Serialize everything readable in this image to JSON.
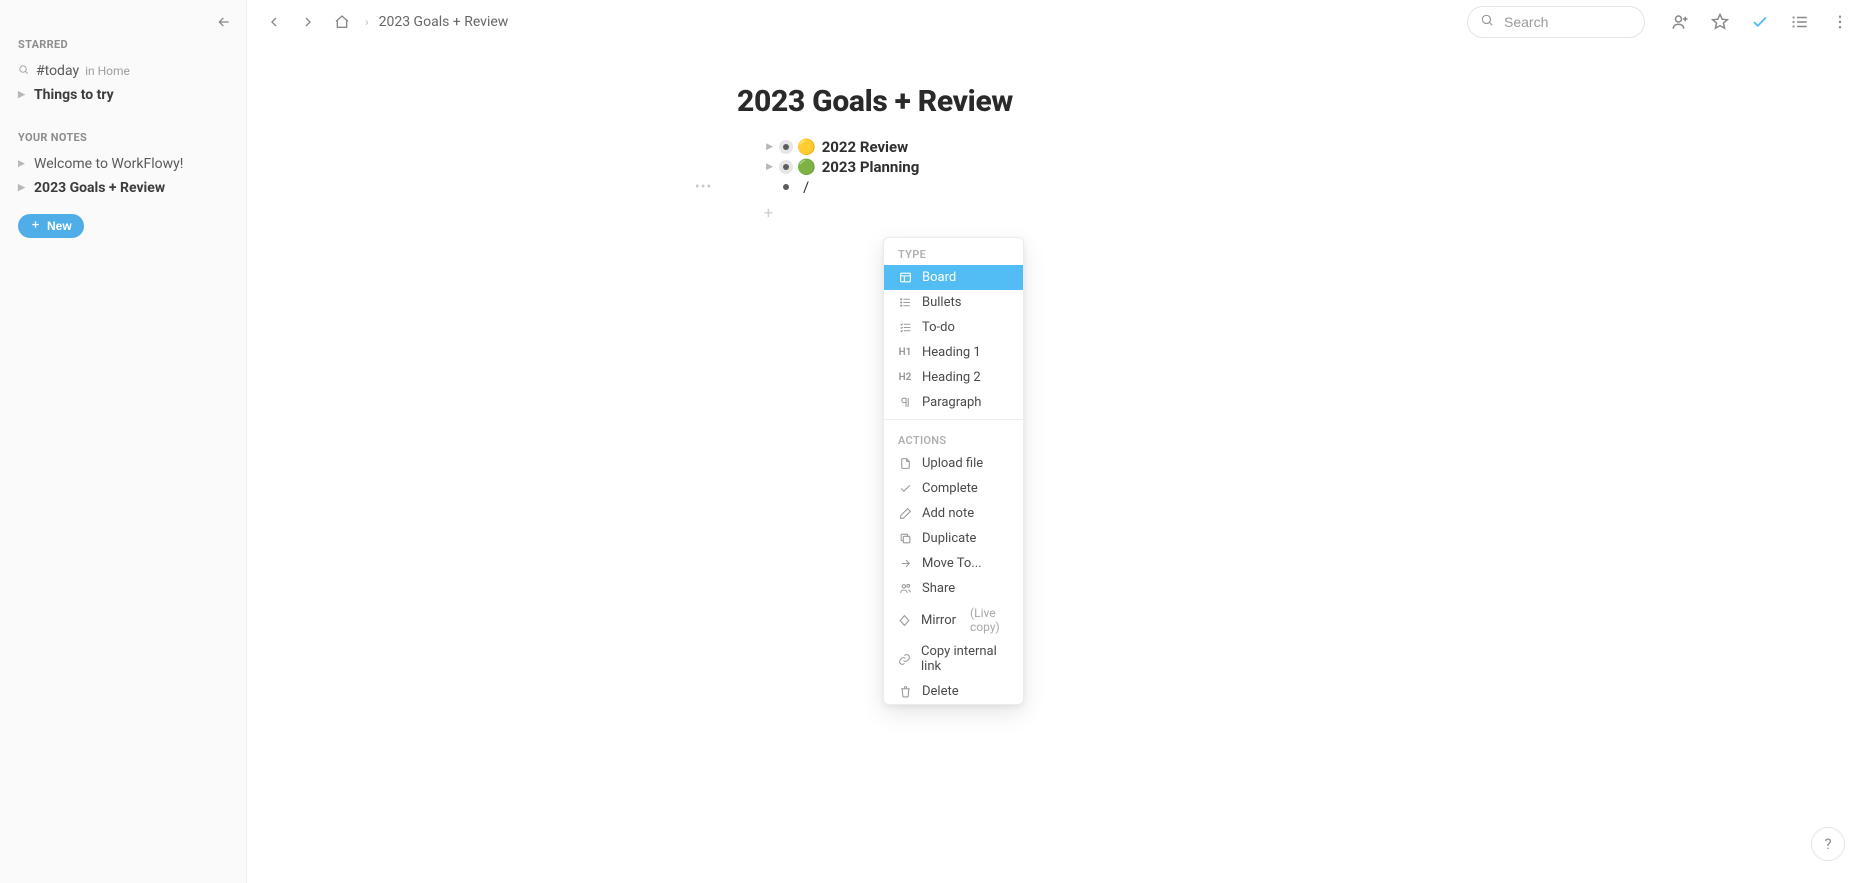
{
  "sidebar": {
    "starred_label": "STARRED",
    "today": {
      "tag": "#today",
      "in_label": "in Home"
    },
    "things_to_try": "Things to try",
    "your_notes_label": "YOUR NOTES",
    "notes": [
      {
        "label": "Welcome to WorkFlowy!"
      },
      {
        "label": "2023 Goals + Review"
      }
    ],
    "new_label": "New"
  },
  "topbar": {
    "breadcrumb": "2023 Goals + Review",
    "search_placeholder": "Search"
  },
  "doc": {
    "title": "2023 Goals + Review",
    "items": [
      {
        "emoji": "🟡",
        "label": "2022 Review"
      },
      {
        "emoji": "🟢",
        "label": "2023 Planning"
      }
    ],
    "slash_input": "/"
  },
  "popup": {
    "type_label": "TYPE",
    "types": [
      {
        "label": "Board",
        "icon": "board",
        "selected": true
      },
      {
        "label": "Bullets",
        "icon": "bullets"
      },
      {
        "label": "To-do",
        "icon": "todo"
      },
      {
        "label": "Heading 1",
        "icon": "H1"
      },
      {
        "label": "Heading 2",
        "icon": "H2"
      },
      {
        "label": "Paragraph",
        "icon": "paragraph"
      }
    ],
    "actions_label": "ACTIONS",
    "actions": [
      {
        "label": "Upload file",
        "icon": "file"
      },
      {
        "label": "Complete",
        "icon": "check"
      },
      {
        "label": "Add note",
        "icon": "pencil"
      },
      {
        "label": "Duplicate",
        "icon": "duplicate"
      },
      {
        "label": "Move To...",
        "icon": "arrow"
      },
      {
        "label": "Share",
        "icon": "people"
      },
      {
        "label": "Mirror",
        "icon": "diamond",
        "hint": "(Live copy)"
      },
      {
        "label": "Copy internal link",
        "icon": "link"
      },
      {
        "label": "Delete",
        "icon": "trash"
      }
    ]
  },
  "help_label": "?"
}
